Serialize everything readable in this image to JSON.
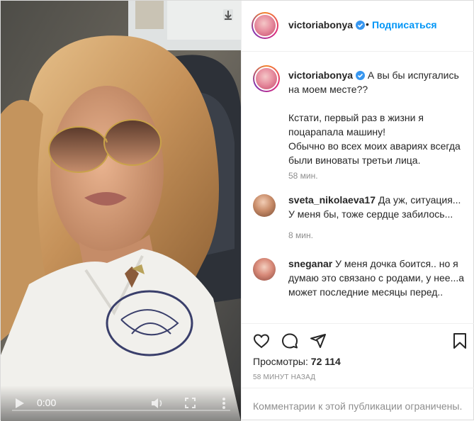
{
  "post": {
    "username": "victoriabonya",
    "follow_label": "Подписаться",
    "separator": "•"
  },
  "video": {
    "current_time": "0:00",
    "progress": 0
  },
  "caption": {
    "username": "victoriabonya",
    "line1": "А вы бы испугались на моем месте??",
    "line2": "Кстати, первый раз в жизни я поцарапала машину!",
    "line3": "Обычно во всех моих авариях всегда были виноваты третьи лица.",
    "time": "58 мин."
  },
  "comments": [
    {
      "username": "sveta_nikolaeva17",
      "text": "Да уж, ситуация... У меня бы, тоже сердце забилось...",
      "time": "8 мин."
    },
    {
      "username": "sneganar",
      "text": "У меня дочка боится.. но я думаю это связано с родами, у нее...а может последние месяцы перед..",
      "time": ""
    }
  ],
  "stats": {
    "views_label": "Просмотры:",
    "views_count": "72 114",
    "posted_ago": "58 МИНУТ НАЗАД"
  },
  "footer": {
    "restricted_text": "Комментарии к этой публикации ограничены."
  },
  "colors": {
    "accent": "#0095f6",
    "muted": "#8e8e8e",
    "border": "#efefef"
  },
  "icons": [
    "download-icon",
    "play-icon",
    "volume-icon",
    "fullscreen-icon",
    "more-icon",
    "verified-icon",
    "heart-icon",
    "comment-icon",
    "share-icon",
    "bookmark-icon"
  ]
}
